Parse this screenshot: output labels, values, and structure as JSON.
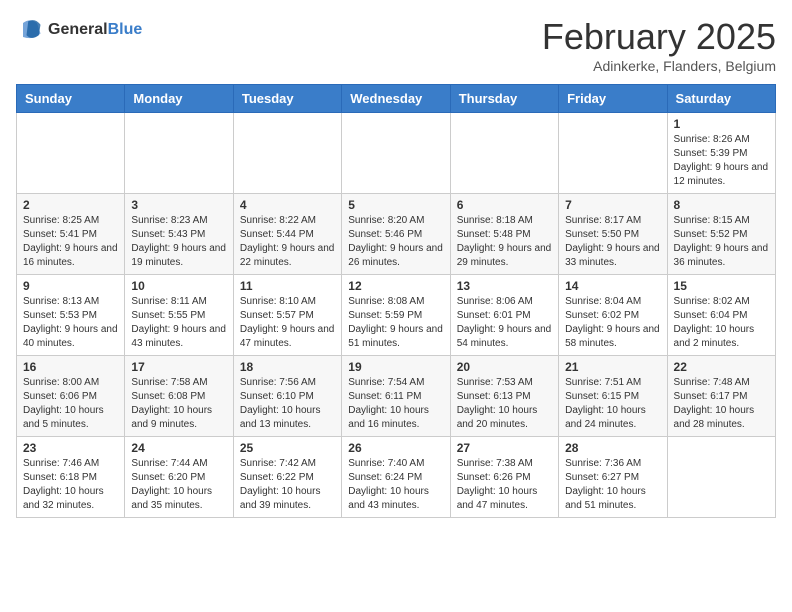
{
  "logo": {
    "line1": "General",
    "line2": "Blue"
  },
  "title": "February 2025",
  "subtitle": "Adinkerke, Flanders, Belgium",
  "days": [
    "Sunday",
    "Monday",
    "Tuesday",
    "Wednesday",
    "Thursday",
    "Friday",
    "Saturday"
  ],
  "weeks": [
    [
      {
        "day": "",
        "info": ""
      },
      {
        "day": "",
        "info": ""
      },
      {
        "day": "",
        "info": ""
      },
      {
        "day": "",
        "info": ""
      },
      {
        "day": "",
        "info": ""
      },
      {
        "day": "",
        "info": ""
      },
      {
        "day": "1",
        "info": "Sunrise: 8:26 AM\nSunset: 5:39 PM\nDaylight: 9 hours and 12 minutes."
      }
    ],
    [
      {
        "day": "2",
        "info": "Sunrise: 8:25 AM\nSunset: 5:41 PM\nDaylight: 9 hours and 16 minutes."
      },
      {
        "day": "3",
        "info": "Sunrise: 8:23 AM\nSunset: 5:43 PM\nDaylight: 9 hours and 19 minutes."
      },
      {
        "day": "4",
        "info": "Sunrise: 8:22 AM\nSunset: 5:44 PM\nDaylight: 9 hours and 22 minutes."
      },
      {
        "day": "5",
        "info": "Sunrise: 8:20 AM\nSunset: 5:46 PM\nDaylight: 9 hours and 26 minutes."
      },
      {
        "day": "6",
        "info": "Sunrise: 8:18 AM\nSunset: 5:48 PM\nDaylight: 9 hours and 29 minutes."
      },
      {
        "day": "7",
        "info": "Sunrise: 8:17 AM\nSunset: 5:50 PM\nDaylight: 9 hours and 33 minutes."
      },
      {
        "day": "8",
        "info": "Sunrise: 8:15 AM\nSunset: 5:52 PM\nDaylight: 9 hours and 36 minutes."
      }
    ],
    [
      {
        "day": "9",
        "info": "Sunrise: 8:13 AM\nSunset: 5:53 PM\nDaylight: 9 hours and 40 minutes."
      },
      {
        "day": "10",
        "info": "Sunrise: 8:11 AM\nSunset: 5:55 PM\nDaylight: 9 hours and 43 minutes."
      },
      {
        "day": "11",
        "info": "Sunrise: 8:10 AM\nSunset: 5:57 PM\nDaylight: 9 hours and 47 minutes."
      },
      {
        "day": "12",
        "info": "Sunrise: 8:08 AM\nSunset: 5:59 PM\nDaylight: 9 hours and 51 minutes."
      },
      {
        "day": "13",
        "info": "Sunrise: 8:06 AM\nSunset: 6:01 PM\nDaylight: 9 hours and 54 minutes."
      },
      {
        "day": "14",
        "info": "Sunrise: 8:04 AM\nSunset: 6:02 PM\nDaylight: 9 hours and 58 minutes."
      },
      {
        "day": "15",
        "info": "Sunrise: 8:02 AM\nSunset: 6:04 PM\nDaylight: 10 hours and 2 minutes."
      }
    ],
    [
      {
        "day": "16",
        "info": "Sunrise: 8:00 AM\nSunset: 6:06 PM\nDaylight: 10 hours and 5 minutes."
      },
      {
        "day": "17",
        "info": "Sunrise: 7:58 AM\nSunset: 6:08 PM\nDaylight: 10 hours and 9 minutes."
      },
      {
        "day": "18",
        "info": "Sunrise: 7:56 AM\nSunset: 6:10 PM\nDaylight: 10 hours and 13 minutes."
      },
      {
        "day": "19",
        "info": "Sunrise: 7:54 AM\nSunset: 6:11 PM\nDaylight: 10 hours and 16 minutes."
      },
      {
        "day": "20",
        "info": "Sunrise: 7:53 AM\nSunset: 6:13 PM\nDaylight: 10 hours and 20 minutes."
      },
      {
        "day": "21",
        "info": "Sunrise: 7:51 AM\nSunset: 6:15 PM\nDaylight: 10 hours and 24 minutes."
      },
      {
        "day": "22",
        "info": "Sunrise: 7:48 AM\nSunset: 6:17 PM\nDaylight: 10 hours and 28 minutes."
      }
    ],
    [
      {
        "day": "23",
        "info": "Sunrise: 7:46 AM\nSunset: 6:18 PM\nDaylight: 10 hours and 32 minutes."
      },
      {
        "day": "24",
        "info": "Sunrise: 7:44 AM\nSunset: 6:20 PM\nDaylight: 10 hours and 35 minutes."
      },
      {
        "day": "25",
        "info": "Sunrise: 7:42 AM\nSunset: 6:22 PM\nDaylight: 10 hours and 39 minutes."
      },
      {
        "day": "26",
        "info": "Sunrise: 7:40 AM\nSunset: 6:24 PM\nDaylight: 10 hours and 43 minutes."
      },
      {
        "day": "27",
        "info": "Sunrise: 7:38 AM\nSunset: 6:26 PM\nDaylight: 10 hours and 47 minutes."
      },
      {
        "day": "28",
        "info": "Sunrise: 7:36 AM\nSunset: 6:27 PM\nDaylight: 10 hours and 51 minutes."
      },
      {
        "day": "",
        "info": ""
      }
    ]
  ]
}
